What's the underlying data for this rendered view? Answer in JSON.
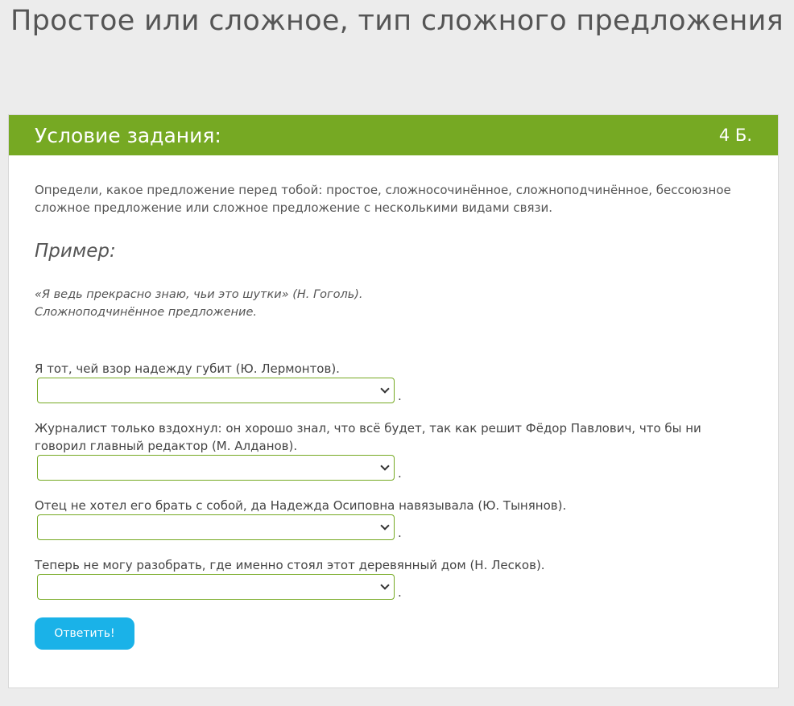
{
  "page": {
    "title": "Простое или сложное, тип сложного предложения"
  },
  "card": {
    "header_title": "Условие задания:",
    "points": "4 Б.",
    "instructions": "Определи, какое предложение перед тобой: простое, сложносочинённое, сложноподчинённое, бессоюзное сложное предложение или сложное предложение с несколькими видами связи.",
    "example_heading": "Пример:",
    "example_line1": "«Я ведь прекрасно знаю, чьи это шутки» (Н. Гоголь).",
    "example_line2": "Сложноподчинённое предложение."
  },
  "tasks": [
    {
      "question": "Я тот, чей взор надежду губит (Ю. Лермонтов).",
      "selected": "",
      "suffix": "."
    },
    {
      "question": "Журналист только вздохнул: он хорошо знал, что всё будет, так как решит Фёдор Павлович, что бы ни говорил главный редактор (М. Алданов).",
      "selected": "",
      "suffix": "."
    },
    {
      "question": "Отец не хотел его брать с собой, да Надежда Осиповна навязывала (Ю. Тынянов).",
      "selected": "",
      "suffix": "."
    },
    {
      "question": "Теперь не могу разобрать, где именно стоял этот деревянный дом (Н. Лесков).",
      "selected": "",
      "suffix": "."
    }
  ],
  "submit_label": "Ответить!",
  "colors": {
    "header_green": "#76a923",
    "button_blue": "#1ab2e8",
    "background": "#ececec"
  }
}
